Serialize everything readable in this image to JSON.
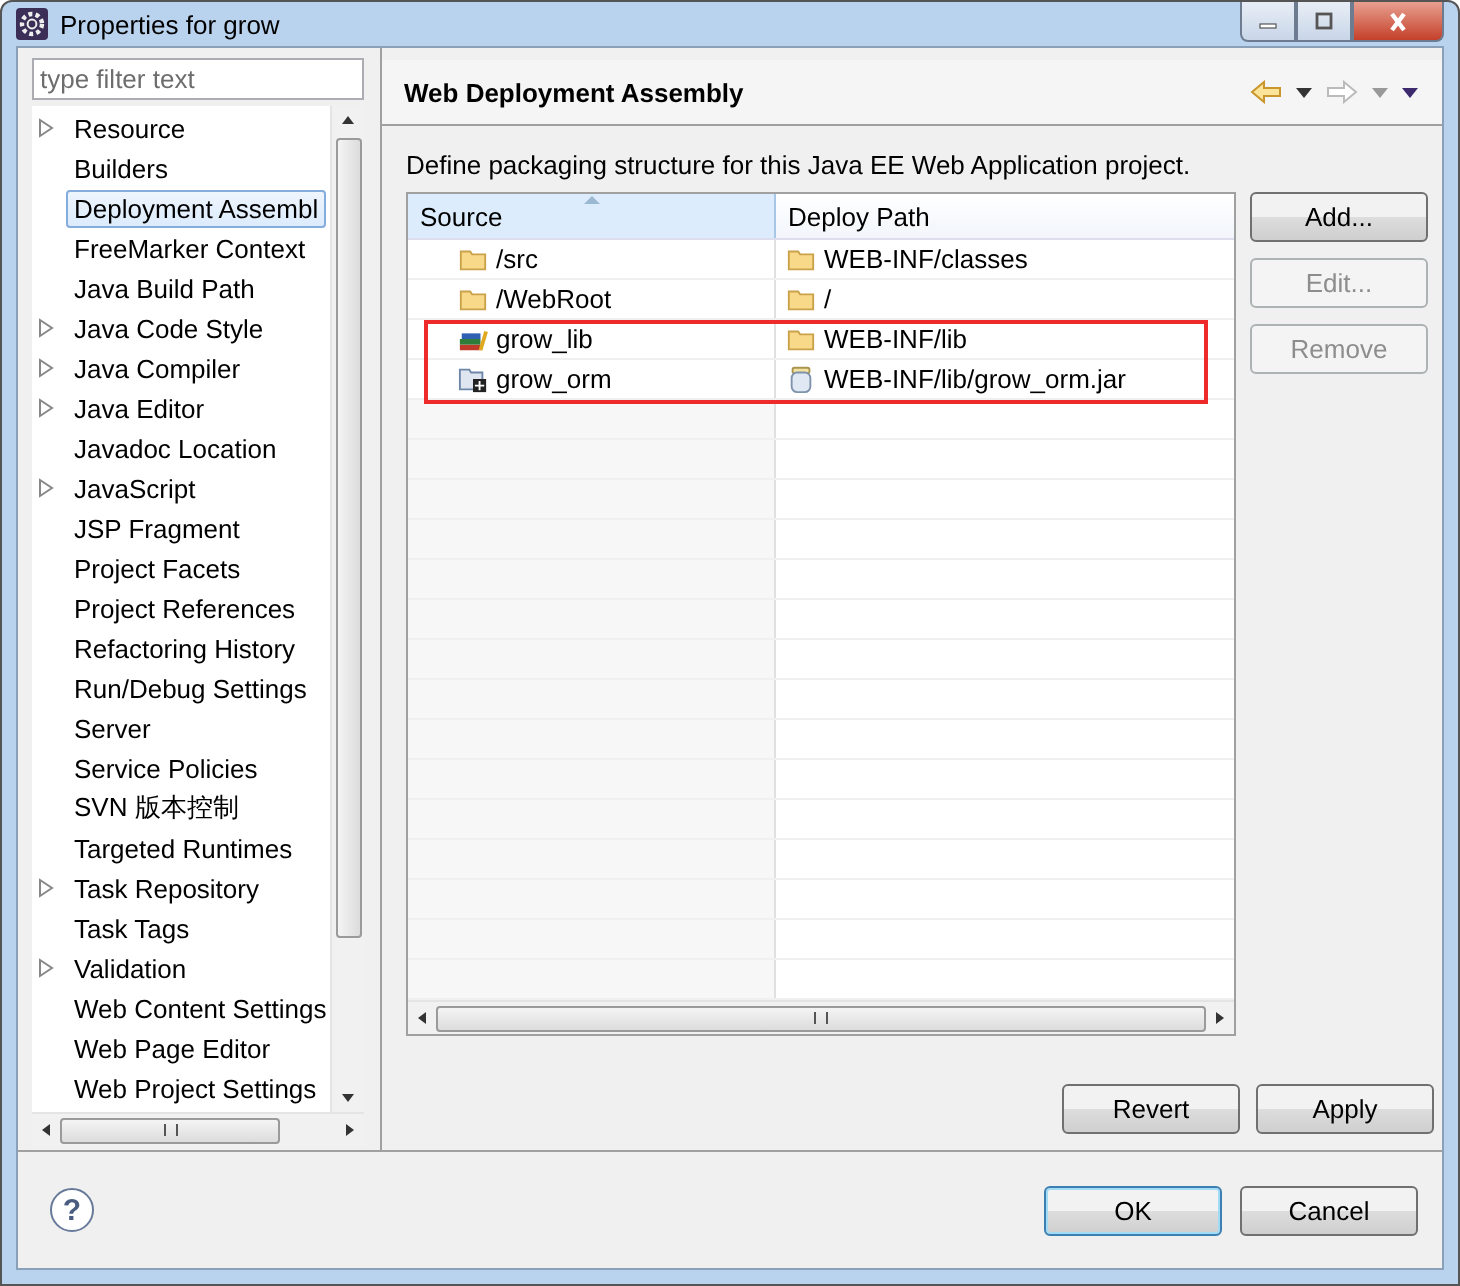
{
  "window": {
    "title": "Properties for grow"
  },
  "filter": {
    "placeholder": "type filter text"
  },
  "sidebar": {
    "items": [
      {
        "label": "Resource",
        "expandable": true,
        "selected": false
      },
      {
        "label": "Builders",
        "expandable": false,
        "selected": false
      },
      {
        "label": "Deployment Assembl",
        "expandable": false,
        "selected": true
      },
      {
        "label": "FreeMarker Context",
        "expandable": false,
        "selected": false
      },
      {
        "label": "Java Build Path",
        "expandable": false,
        "selected": false
      },
      {
        "label": "Java Code Style",
        "expandable": true,
        "selected": false
      },
      {
        "label": "Java Compiler",
        "expandable": true,
        "selected": false
      },
      {
        "label": "Java Editor",
        "expandable": true,
        "selected": false
      },
      {
        "label": "Javadoc Location",
        "expandable": false,
        "selected": false
      },
      {
        "label": "JavaScript",
        "expandable": true,
        "selected": false
      },
      {
        "label": "JSP Fragment",
        "expandable": false,
        "selected": false
      },
      {
        "label": "Project Facets",
        "expandable": false,
        "selected": false
      },
      {
        "label": "Project References",
        "expandable": false,
        "selected": false
      },
      {
        "label": "Refactoring History",
        "expandable": false,
        "selected": false
      },
      {
        "label": "Run/Debug Settings",
        "expandable": false,
        "selected": false
      },
      {
        "label": "Server",
        "expandable": false,
        "selected": false
      },
      {
        "label": "Service Policies",
        "expandable": false,
        "selected": false
      },
      {
        "label": "SVN 版本控制",
        "expandable": false,
        "selected": false
      },
      {
        "label": "Targeted Runtimes",
        "expandable": false,
        "selected": false
      },
      {
        "label": "Task Repository",
        "expandable": true,
        "selected": false
      },
      {
        "label": "Task Tags",
        "expandable": false,
        "selected": false
      },
      {
        "label": "Validation",
        "expandable": true,
        "selected": false
      },
      {
        "label": "Web Content Settings",
        "expandable": false,
        "selected": false
      },
      {
        "label": "Web Page Editor",
        "expandable": false,
        "selected": false
      },
      {
        "label": "Web Project Settings",
        "expandable": false,
        "selected": false
      }
    ]
  },
  "page": {
    "title": "Web Deployment Assembly",
    "description": "Define packaging structure for this Java EE Web Application project."
  },
  "table": {
    "columns": [
      "Source",
      "Deploy Path"
    ],
    "rows": [
      {
        "source": {
          "label": "/src",
          "kind": "folder"
        },
        "path": {
          "label": "WEB-INF/classes",
          "kind": "folder"
        },
        "highlighted": false
      },
      {
        "source": {
          "label": "/WebRoot",
          "kind": "folder"
        },
        "path": {
          "label": "/",
          "kind": "folder"
        },
        "highlighted": false
      },
      {
        "source": {
          "label": "grow_lib",
          "kind": "library"
        },
        "path": {
          "label": "WEB-INF/lib",
          "kind": "folder"
        },
        "highlighted": true
      },
      {
        "source": {
          "label": "grow_orm",
          "kind": "project"
        },
        "path": {
          "label": "WEB-INF/lib/grow_orm.jar",
          "kind": "jar"
        },
        "highlighted": true
      }
    ]
  },
  "side_buttons": [
    {
      "label": "Add...",
      "disabled": false
    },
    {
      "label": "Edit...",
      "disabled": true
    },
    {
      "label": "Remove",
      "disabled": true
    }
  ],
  "page_buttons": [
    {
      "label": "Revert",
      "default": false
    },
    {
      "label": "Apply",
      "default": false
    }
  ],
  "help_button": {
    "label": "?"
  },
  "dialog_buttons": [
    {
      "label": "OK",
      "default": true
    },
    {
      "label": "Cancel",
      "default": false
    }
  ]
}
